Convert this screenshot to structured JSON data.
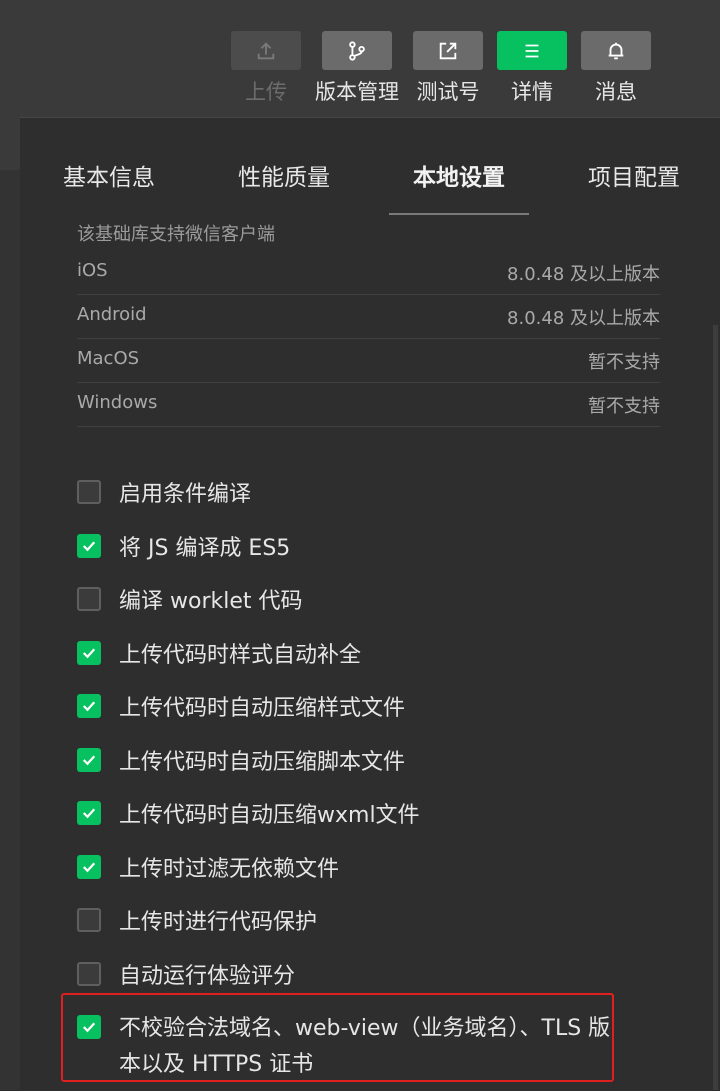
{
  "toolbar": {
    "buttons": [
      {
        "label": "上传",
        "icon": "upload-icon",
        "state": "disabled"
      },
      {
        "label": "版本管理",
        "icon": "branch-icon",
        "state": "normal"
      },
      {
        "label": "测试号",
        "icon": "external-link-icon",
        "state": "normal"
      },
      {
        "label": "详情",
        "icon": "menu-icon",
        "state": "active"
      },
      {
        "label": "消息",
        "icon": "bell-icon",
        "state": "normal"
      }
    ]
  },
  "tabs": [
    {
      "label": "基本信息"
    },
    {
      "label": "性能质量"
    },
    {
      "label": "本地设置",
      "active": true
    },
    {
      "label": "项目配置"
    }
  ],
  "support": {
    "title": "该基础库支持微信客户端",
    "rows": [
      {
        "platform": "iOS",
        "value": "8.0.48 及以上版本"
      },
      {
        "platform": "Android",
        "value": "8.0.48 及以上版本"
      },
      {
        "platform": "MacOS",
        "value": "暂不支持"
      },
      {
        "platform": "Windows",
        "value": "暂不支持"
      }
    ]
  },
  "options": [
    {
      "label": "启用条件编译",
      "checked": false
    },
    {
      "label": "将 JS 编译成 ES5",
      "checked": true
    },
    {
      "label": "编译 worklet 代码",
      "checked": false
    },
    {
      "label": "上传代码时样式自动补全",
      "checked": true
    },
    {
      "label": "上传代码时自动压缩样式文件",
      "checked": true
    },
    {
      "label": "上传代码时自动压缩脚本文件",
      "checked": true
    },
    {
      "label": "上传代码时自动压缩wxml文件",
      "checked": true
    },
    {
      "label": "上传时过滤无依赖文件",
      "checked": true
    },
    {
      "label": "上传时进行代码保护",
      "checked": false
    },
    {
      "label": "自动运行体验评分",
      "checked": false
    },
    {
      "label": "不校验合法域名、web-view（业务域名）、TLS 版本以及 HTTPS 证书",
      "checked": true
    }
  ],
  "colors": {
    "accent": "#07c160",
    "highlight": "#e02020"
  }
}
